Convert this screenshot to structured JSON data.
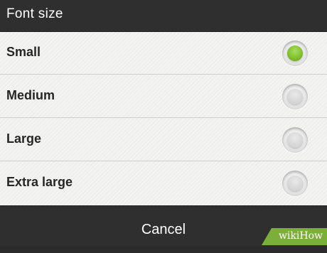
{
  "dialog": {
    "title": "Font size",
    "options": [
      {
        "label": "Small",
        "selected": true
      },
      {
        "label": "Medium",
        "selected": false
      },
      {
        "label": "Large",
        "selected": false
      },
      {
        "label": "Extra large",
        "selected": false
      }
    ],
    "cancel_label": "Cancel"
  },
  "watermark": {
    "text": "wikiHow"
  },
  "colors": {
    "title_bar": "#2f2f2f",
    "selected_radio": "#7fbe2c",
    "watermark_bg": "#7cae3a"
  },
  "icons": {
    "radio_selected": "radio-checked-icon",
    "radio_unselected": "radio-unchecked-icon"
  }
}
